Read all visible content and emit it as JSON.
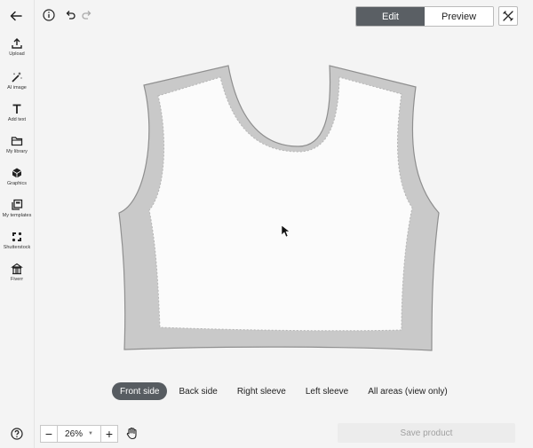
{
  "header": {
    "modes": [
      {
        "label": "Edit",
        "active": true
      },
      {
        "label": "Preview",
        "active": false
      }
    ]
  },
  "sidebar": {
    "items": [
      {
        "label": "Upload",
        "icon": "upload-icon"
      },
      {
        "label": "AI image",
        "icon": "magic-wand-icon"
      },
      {
        "label": "Add text",
        "icon": "text-icon"
      },
      {
        "label": "My library",
        "icon": "folder-icon"
      },
      {
        "label": "Graphics",
        "icon": "shapes-icon"
      },
      {
        "label": "My templates",
        "icon": "templates-icon"
      },
      {
        "label": "Shutterstock",
        "icon": "shutterstock-icon"
      },
      {
        "label": "Fiverr",
        "icon": "fiverr-icon"
      }
    ]
  },
  "side_tabs": [
    {
      "label": "Front side",
      "active": true
    },
    {
      "label": "Back side",
      "active": false
    },
    {
      "label": "Right sleeve",
      "active": false
    },
    {
      "label": "Left sleeve",
      "active": false
    },
    {
      "label": "All areas (view only)",
      "active": false
    }
  ],
  "footer": {
    "zoom": "26%",
    "zoom_minus": "−",
    "zoom_plus": "+",
    "save_label": "Save product"
  },
  "colors": {
    "accent": "#5a5f64",
    "garment_border": "#c9c9c9",
    "garment_fill": "#fbfbfb"
  }
}
